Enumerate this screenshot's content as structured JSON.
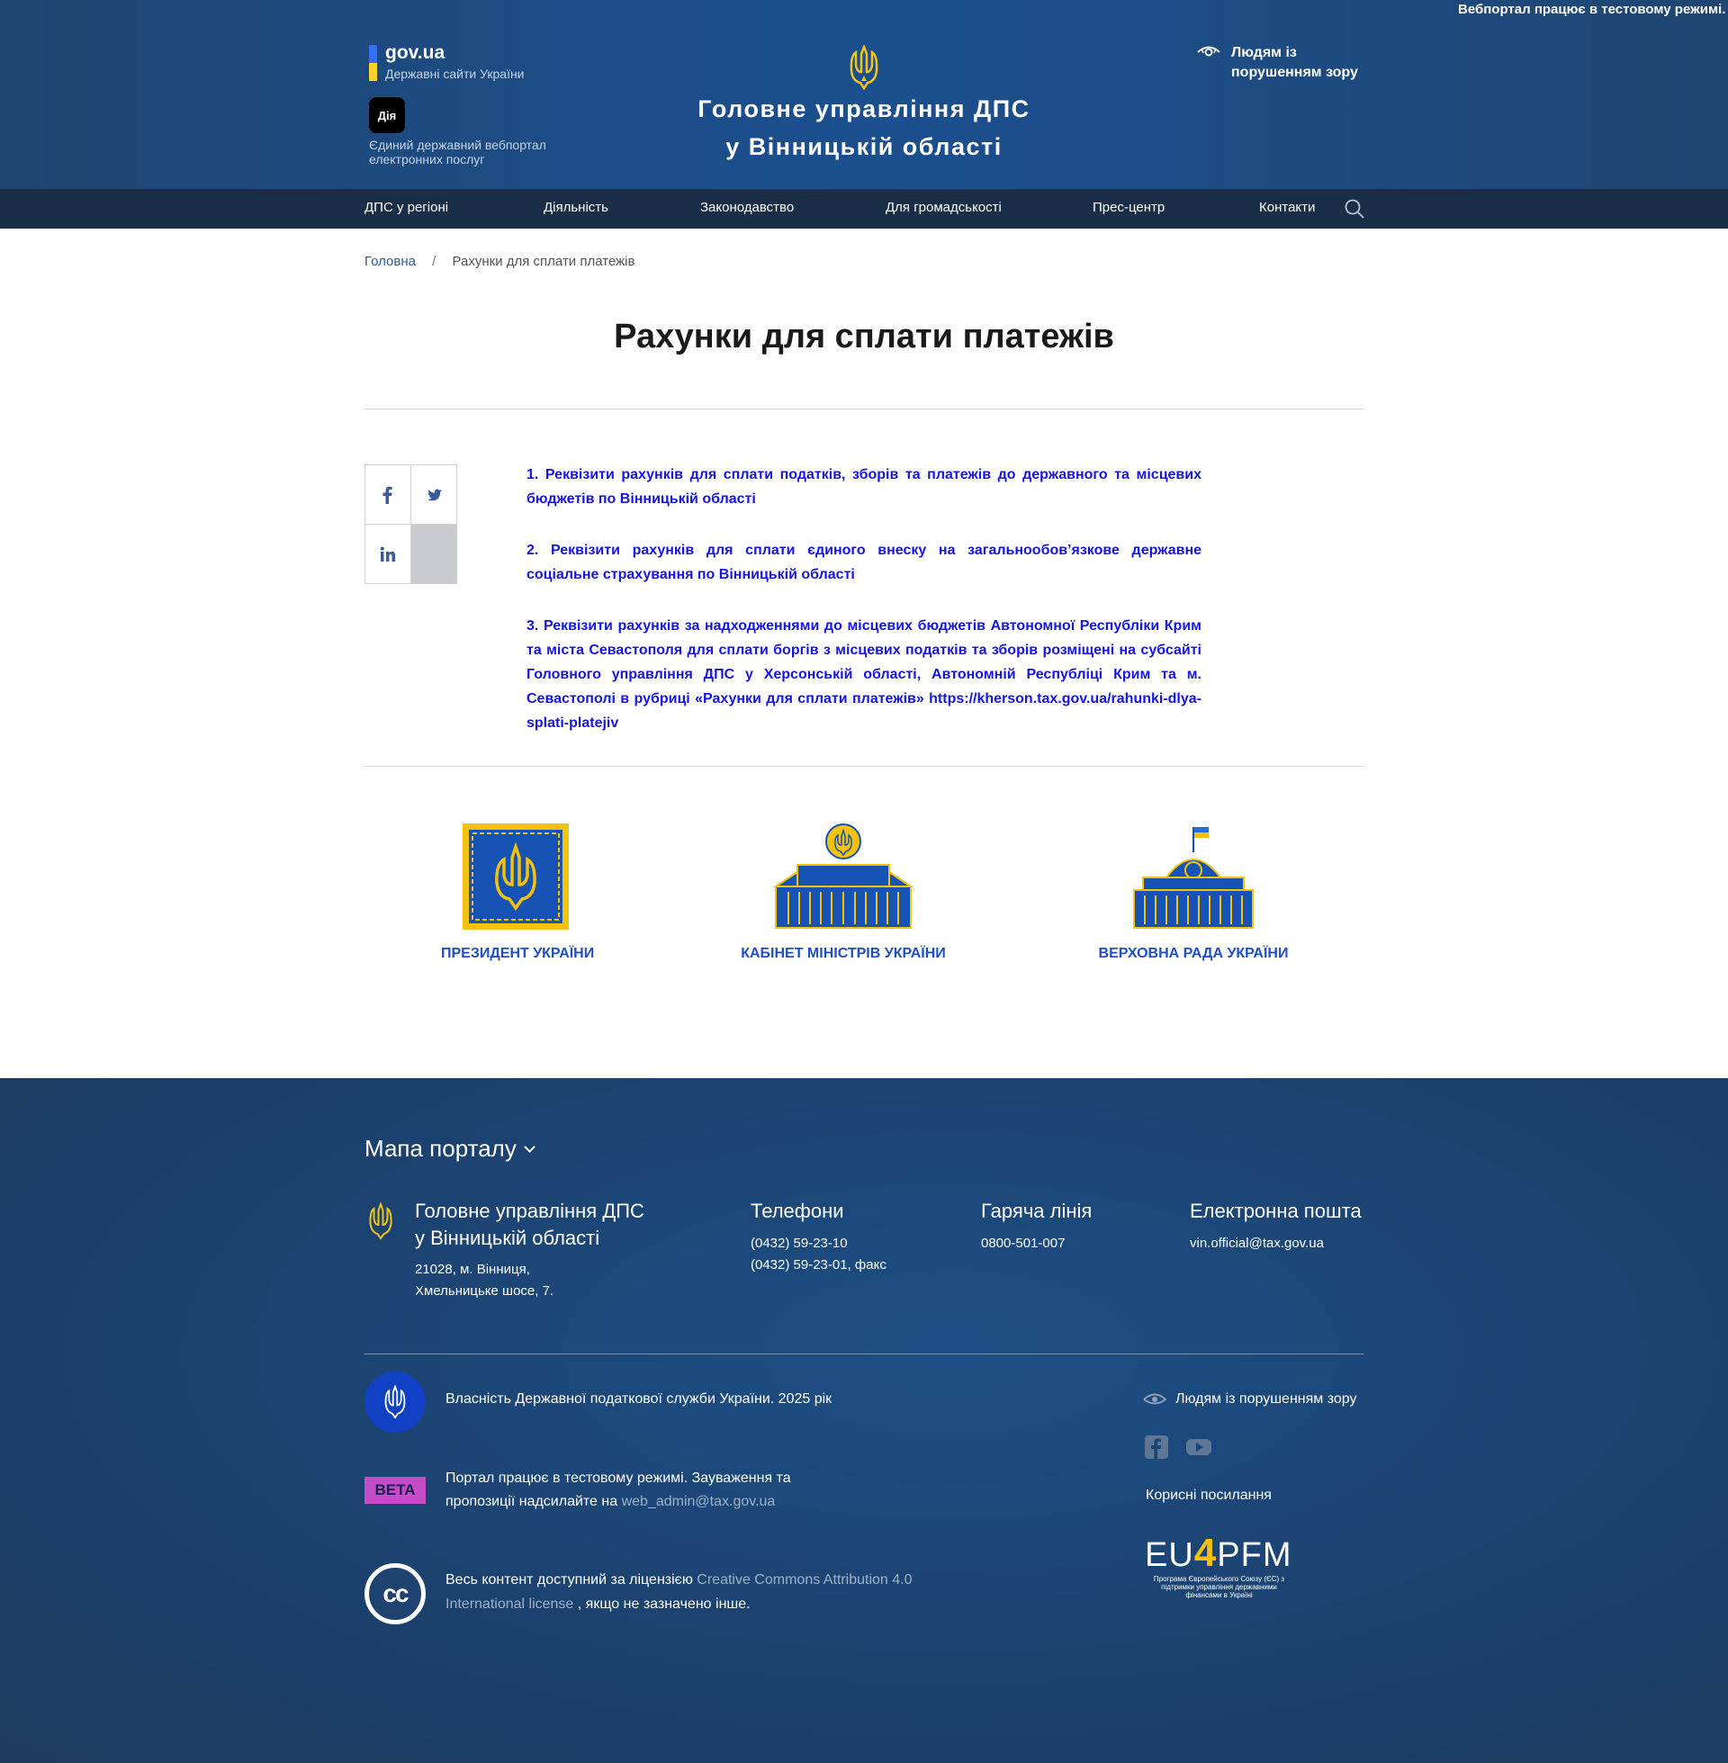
{
  "header": {
    "ticker": "Вебпортал працює в тестовому режимі. Зауваження",
    "govua_title": "gov.ua",
    "govua_subtitle": "Державні сайти України",
    "diia_label": "Дія",
    "diia_text": "Єдиний державний вебпортал електронних послуг",
    "site_title_line1": "Головне управління ДПС",
    "site_title_line2": "у Вінницькій області",
    "vision_label": "Людям із порушенням зору"
  },
  "nav": {
    "items": [
      "ДПС у регіоні",
      "Діяльність",
      "Законодавство",
      "Для громадськості",
      "Прес-центр",
      "Контакти"
    ]
  },
  "breadcrumb": {
    "home": "Головна",
    "separator": "/",
    "current": "Рахунки для сплати платежів"
  },
  "page": {
    "title": "Рахунки для сплати платежів",
    "paragraphs": [
      "1. Реквізити рахунків для сплати податків, зборів та платежів до державного та місцевих бюджетів по Вінницькій області",
      "2. Реквізити рахунків для сплати єдиного внеску на загальнообов’язкове державне соціальне страхування по Вінницькій області",
      "3. Реквізити рахунків за надходженнями до місцевих бюджетів Автономної Республіки Крим та міста Севастополя для сплати боргів з місцевих податків та зборів розміщені на субсайті Головного управління ДПС у Херсонській області, Автономній Республіці Крим та м. Севастополі в рубриці «Рахунки для сплати платежів» https://kherson.tax.gov.ua/rahunki-dlya-splati-platejiv"
    ]
  },
  "share": {
    "icons": [
      "facebook-icon",
      "twitter-icon",
      "linkedin-icon"
    ]
  },
  "orgs": [
    {
      "label": "ПРЕЗИДЕНТ УКРАЇНИ"
    },
    {
      "label": "КАБІНЕТ МІНІСТРІВ УКРАЇНИ"
    },
    {
      "label": "ВЕРХОВНА РАДА УКРАЇНИ"
    }
  ],
  "footer": {
    "map_title": "Мапа порталу",
    "org_line1": "Головне управління ДПС",
    "org_line2": "у Вінницькій області",
    "address_line1": "21028, м. Вінниця,",
    "address_line2": "Хмельницьке шосе, 7.",
    "phones_title": "Телефони",
    "phone1": "(0432) 59-23-10",
    "phone2": "(0432) 59-23-01, факс",
    "hotline_title": "Гаряча лінія",
    "hotline": "0800-501-007",
    "email_title": "Електронна пошта",
    "email": "vin.official@tax.gov.ua",
    "property": "Власність Державної податкової служби України. 2025 рік",
    "beta_badge": "BETA",
    "beta_text_prefix": "Портал працює в тестовому режимі. Зауваження та пропозиції надсилайте на",
    "beta_email": "web_admin@tax.gov.ua",
    "cc_logo": "cc",
    "cc_prefix": "Весь контент доступний за ліцензією",
    "cc_link": "Creative Commons Attribution 4.0 International license",
    "cc_suffix": ", якщо не зазначено інше.",
    "vision_label": "Людям із порушенням зору",
    "useful_links": "Корисні посилання",
    "eu4pfm_eu": "EU",
    "eu4pfm_4": "4",
    "eu4pfm_pfm": "PFM",
    "eu4pfm_sub": "Програма Європейського Союзу (ЄС) з підтримки управління державними фінансами в Україні"
  },
  "colors": {
    "header_bg": "#1b4f8f",
    "nav_bg": "#1b2e48",
    "link_blue": "#1515e6",
    "org_label": "#1e4fc7",
    "accent_yellow": "#ffd32a",
    "beta": "#c54bc9"
  }
}
